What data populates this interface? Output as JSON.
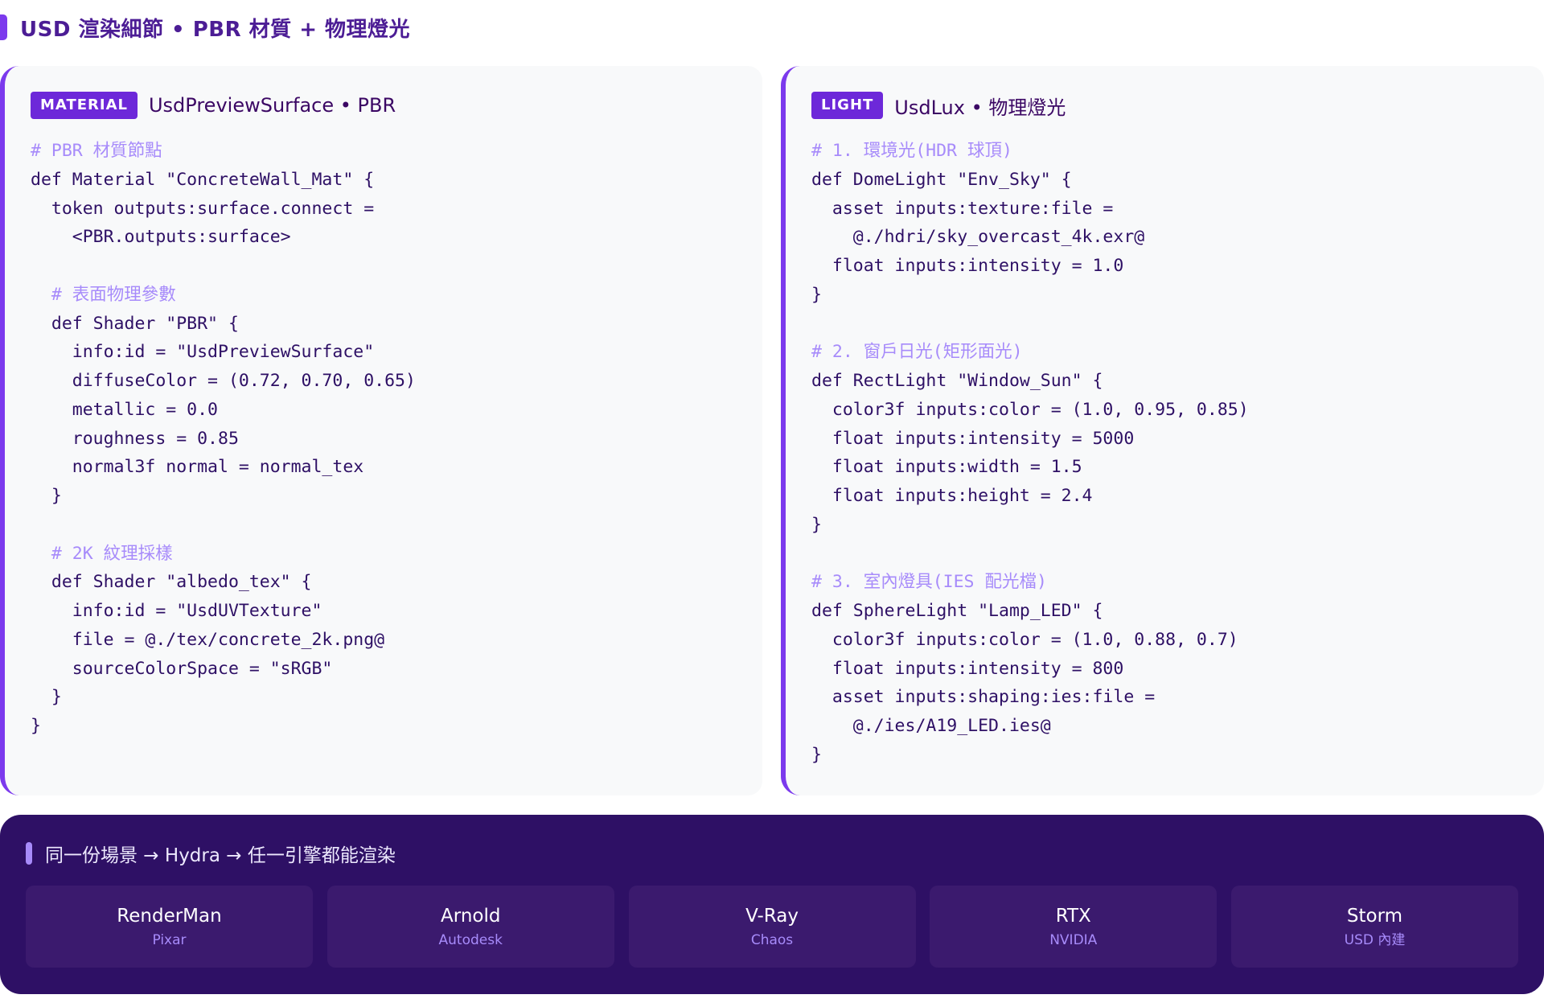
{
  "header": {
    "title": "USD 渲染細節 • PBR 材質 + 物理燈光"
  },
  "material_panel": {
    "tag": "MATERIAL",
    "title": "UsdPreviewSurface • PBR",
    "code": [
      {
        "text": "# PBR 材質節點",
        "type": "comment"
      },
      {
        "text": "def Material \"ConcreteWall_Mat\" {",
        "type": "code"
      },
      {
        "text": "  token outputs:surface.connect =",
        "type": "code"
      },
      {
        "text": "    <PBR.outputs:surface>",
        "type": "code"
      },
      {
        "text": "",
        "type": "code"
      },
      {
        "text": "  # 表面物理參數",
        "type": "comment"
      },
      {
        "text": "  def Shader \"PBR\" {",
        "type": "code"
      },
      {
        "text": "    info:id = \"UsdPreviewSurface\"",
        "type": "code"
      },
      {
        "text": "    diffuseColor = (0.72, 0.70, 0.65)",
        "type": "code"
      },
      {
        "text": "    metallic = 0.0",
        "type": "code"
      },
      {
        "text": "    roughness = 0.85",
        "type": "code"
      },
      {
        "text": "    normal3f normal = normal_tex",
        "type": "code"
      },
      {
        "text": "  }",
        "type": "code"
      },
      {
        "text": "",
        "type": "code"
      },
      {
        "text": "  # 2K 紋理採樣",
        "type": "comment"
      },
      {
        "text": "  def Shader \"albedo_tex\" {",
        "type": "code"
      },
      {
        "text": "    info:id = \"UsdUVTexture\"",
        "type": "code"
      },
      {
        "text": "    file = @./tex/concrete_2k.png@",
        "type": "code"
      },
      {
        "text": "    sourceColorSpace = \"sRGB\"",
        "type": "code"
      },
      {
        "text": "  }",
        "type": "code"
      },
      {
        "text": "}",
        "type": "code"
      }
    ]
  },
  "light_panel": {
    "tag": "LIGHT",
    "title": "UsdLux • 物理燈光",
    "code": [
      {
        "text": "# 1. 環境光(HDR 球頂)",
        "type": "comment"
      },
      {
        "text": "def DomeLight \"Env_Sky\" {",
        "type": "code"
      },
      {
        "text": "  asset inputs:texture:file =",
        "type": "code"
      },
      {
        "text": "    @./hdri/sky_overcast_4k.exr@",
        "type": "code"
      },
      {
        "text": "  float inputs:intensity = 1.0",
        "type": "code"
      },
      {
        "text": "}",
        "type": "code"
      },
      {
        "text": "",
        "type": "code"
      },
      {
        "text": "# 2. 窗戶日光(矩形面光)",
        "type": "comment"
      },
      {
        "text": "def RectLight \"Window_Sun\" {",
        "type": "code"
      },
      {
        "text": "  color3f inputs:color = (1.0, 0.95, 0.85)",
        "type": "code"
      },
      {
        "text": "  float inputs:intensity = 5000",
        "type": "code"
      },
      {
        "text": "  float inputs:width = 1.5",
        "type": "code"
      },
      {
        "text": "  float inputs:height = 2.4",
        "type": "code"
      },
      {
        "text": "}",
        "type": "code"
      },
      {
        "text": "",
        "type": "code"
      },
      {
        "text": "# 3. 室內燈具(IES 配光檔)",
        "type": "comment"
      },
      {
        "text": "def SphereLight \"Lamp_LED\" {",
        "type": "code"
      },
      {
        "text": "  color3f inputs:color = (1.0, 0.88, 0.7)",
        "type": "code"
      },
      {
        "text": "  float inputs:intensity = 800",
        "type": "code"
      },
      {
        "text": "  asset inputs:shaping:ies:file =",
        "type": "code"
      },
      {
        "text": "    @./ies/A19_LED.ies@",
        "type": "code"
      },
      {
        "text": "}",
        "type": "code"
      }
    ]
  },
  "engines_section": {
    "title": "同一份場景 → Hydra → 任一引擎都能渲染",
    "engines": [
      {
        "name": "RenderMan",
        "vendor": "Pixar"
      },
      {
        "name": "Arnold",
        "vendor": "Autodesk"
      },
      {
        "name": "V-Ray",
        "vendor": "Chaos"
      },
      {
        "name": "RTX",
        "vendor": "NVIDIA"
      },
      {
        "name": "Storm",
        "vendor": "USD 內建"
      }
    ]
  },
  "colors": {
    "accent": "#7c3aed",
    "tag_bg": "#6d28d9",
    "code_text": "#2e1065",
    "comment": "#a78bfa",
    "bottom_bg": "#2e1065",
    "engine_card": "#3b1a6e"
  }
}
